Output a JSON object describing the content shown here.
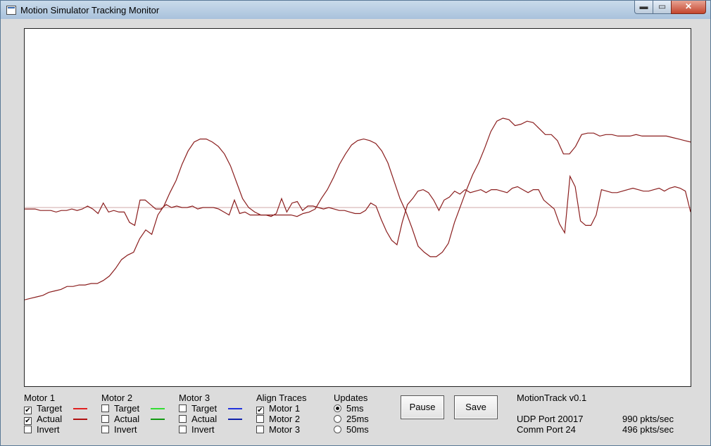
{
  "window": {
    "title": "Motion Simulator Tracking Monitor",
    "min_glyph": "▬",
    "max_glyph": "▭",
    "close_glyph": "✕"
  },
  "chart_data": {
    "type": "line",
    "title": "",
    "xlabel": "",
    "ylabel": "",
    "grid": false,
    "series": [
      {
        "color": "#8a1d1d",
        "values": [
          -0.01,
          -0.01,
          -0.01,
          -0.02,
          -0.02,
          -0.02,
          -0.03,
          -0.02,
          -0.02,
          -0.01,
          -0.02,
          -0.01,
          0.01,
          -0.01,
          -0.04,
          0.03,
          -0.03,
          -0.02,
          -0.03,
          -0.03,
          -0.1,
          -0.12,
          0.05,
          0.05,
          0.02,
          -0.01,
          -0.01,
          0.02,
          0.0,
          0.01,
          0.0,
          0.0,
          0.01,
          -0.01,
          0.0,
          0.0,
          0.0,
          -0.01,
          -0.03,
          -0.05,
          0.05,
          -0.04,
          -0.03,
          -0.05,
          -0.05,
          -0.05,
          -0.05,
          -0.06,
          -0.04,
          0.06,
          -0.03,
          0.03,
          0.04,
          -0.02,
          0.01,
          0.01,
          0.0,
          -0.01,
          0.0,
          -0.01,
          -0.02,
          -0.02,
          -0.03,
          -0.04,
          -0.04,
          -0.02,
          0.03,
          0.01,
          -0.08,
          -0.16,
          -0.22,
          -0.25,
          -0.1,
          0.02,
          0.06,
          0.11,
          0.12,
          0.1,
          0.05,
          -0.02,
          0.05,
          0.07,
          0.11,
          0.09,
          0.12,
          0.1,
          0.11,
          0.12,
          0.1,
          0.12,
          0.12,
          0.11,
          0.1,
          0.13,
          0.14,
          0.12,
          0.1,
          0.12,
          0.12,
          0.05,
          0.02,
          -0.01,
          -0.11,
          -0.17,
          0.21,
          0.14,
          -0.09,
          -0.12,
          -0.12,
          -0.05,
          0.12,
          0.11,
          0.1,
          0.1,
          0.11,
          0.12,
          0.13,
          0.12,
          0.11,
          0.11,
          0.12,
          0.13,
          0.11,
          0.13,
          0.14,
          0.13,
          0.11,
          -0.03
        ]
      },
      {
        "color": "#8a1d1d",
        "values": [
          -0.62,
          -0.61,
          -0.6,
          -0.59,
          -0.57,
          -0.56,
          -0.55,
          -0.53,
          -0.53,
          -0.52,
          -0.52,
          -0.51,
          -0.51,
          -0.49,
          -0.46,
          -0.41,
          -0.35,
          -0.32,
          -0.3,
          -0.21,
          -0.15,
          -0.18,
          -0.05,
          0.01,
          0.1,
          0.18,
          0.29,
          0.38,
          0.44,
          0.46,
          0.46,
          0.44,
          0.41,
          0.36,
          0.28,
          0.17,
          0.06,
          0.0,
          -0.03,
          -0.05,
          -0.05,
          -0.05,
          -0.05,
          -0.05,
          -0.05,
          -0.06,
          -0.04,
          -0.03,
          -0.01,
          0.06,
          0.12,
          0.2,
          0.29,
          0.36,
          0.42,
          0.45,
          0.46,
          0.45,
          0.43,
          0.38,
          0.3,
          0.18,
          0.06,
          -0.03,
          -0.14,
          -0.26,
          -0.3,
          -0.33,
          -0.33,
          -0.3,
          -0.24,
          -0.1,
          0.01,
          0.12,
          0.22,
          0.3,
          0.4,
          0.51,
          0.58,
          0.6,
          0.59,
          0.55,
          0.56,
          0.58,
          0.57,
          0.53,
          0.49,
          0.49,
          0.45,
          0.36,
          0.36,
          0.41,
          0.49,
          0.5,
          0.5,
          0.48,
          0.49,
          0.49,
          0.48,
          0.48,
          0.48,
          0.49,
          0.48,
          0.48,
          0.48,
          0.48,
          0.48,
          0.47,
          0.46,
          0.45,
          0.44
        ]
      }
    ],
    "reference_line": 0.0,
    "ylim": [
      -1.2,
      1.2
    ]
  },
  "motor1": {
    "label": "Motor 1",
    "target": "Target",
    "actual": "Actual",
    "invert": "Invert",
    "target_checked": "✔",
    "actual_checked": "✔",
    "invert_checked": "",
    "target_color": "#e02020",
    "actual_color": "#b01010"
  },
  "motor2": {
    "label": "Motor 2",
    "target": "Target",
    "actual": "Actual",
    "invert": "Invert",
    "target_checked": "",
    "actual_checked": "",
    "invert_checked": "",
    "target_color": "#33dd33",
    "actual_color": "#119911"
  },
  "motor3": {
    "label": "Motor 3",
    "target": "Target",
    "actual": "Actual",
    "invert": "Invert",
    "target_checked": "",
    "actual_checked": "",
    "invert_checked": "",
    "target_color": "#2233dd",
    "actual_color": "#1122aa"
  },
  "align": {
    "label": "Align Traces",
    "m1": "Motor 1",
    "m2": "Motor 2",
    "m3": "Motor 3",
    "m1_checked": "✔",
    "m2_checked": "",
    "m3_checked": ""
  },
  "updates": {
    "label": "Updates",
    "o1": "5ms",
    "o2": "25ms",
    "o3": "50ms",
    "selected": "5ms"
  },
  "buttons": {
    "pause": "Pause",
    "save": "Save"
  },
  "info": {
    "version": "MotionTrack v0.1",
    "udp": "UDP Port 20017",
    "comm": "Comm Port 24",
    "udp_rate": "990 pkts/sec",
    "comm_rate": "496 pkts/sec"
  }
}
